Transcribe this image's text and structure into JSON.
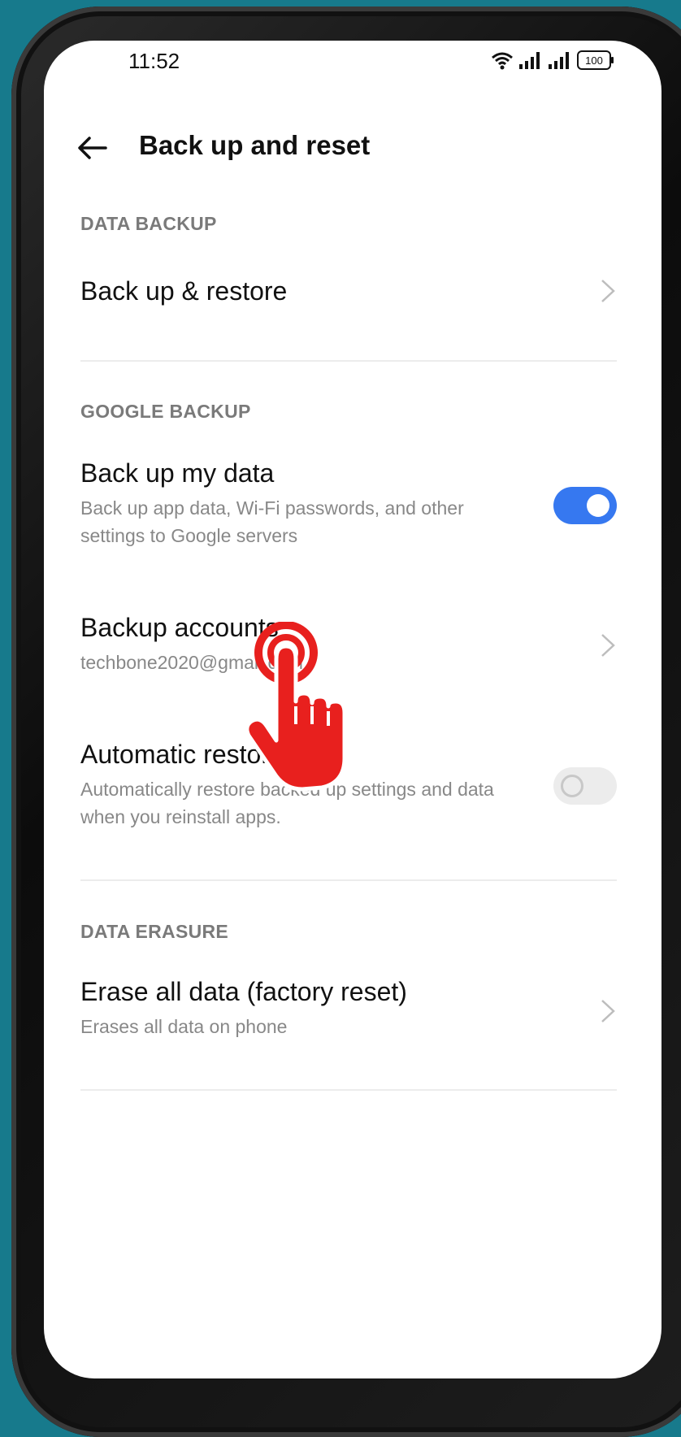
{
  "status_bar": {
    "time": "11:52",
    "battery": "100",
    "icons": [
      "wifi-icon",
      "signal-icon",
      "signal-icon",
      "battery-icon"
    ]
  },
  "header": {
    "title": "Back up and reset",
    "back_icon": "back-arrow-icon"
  },
  "sections": {
    "data_backup": {
      "header": "DATA BACKUP",
      "backup_restore": {
        "title": "Back up & restore"
      }
    },
    "google_backup": {
      "header": "GOOGLE BACKUP",
      "backup_my_data": {
        "title": "Back up my data",
        "subtitle": "Back up app data, Wi-Fi passwords, and other settings to Google servers",
        "enabled": true
      },
      "backup_accounts": {
        "title": "Backup accounts",
        "subtitle": "techbone2020@gmail.com"
      },
      "automatic_restore": {
        "title": "Automatic restore",
        "subtitle": "Automatically restore backed up settings and data when you reinstall apps.",
        "enabled": false
      }
    },
    "data_erasure": {
      "header": "DATA ERASURE",
      "erase_all": {
        "title": "Erase all data (factory reset)",
        "subtitle": "Erases all data on phone"
      }
    }
  },
  "colors": {
    "background": "#177a8c",
    "accent": "#3678f0",
    "tap_indicator": "#e8201e"
  }
}
